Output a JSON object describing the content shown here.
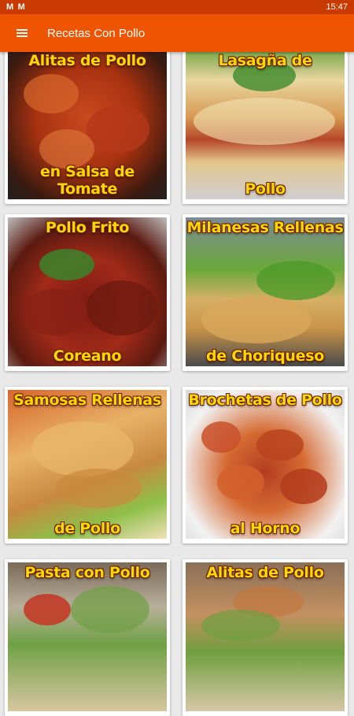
{
  "status_bar": {
    "left_icons": [
      "M",
      "M"
    ],
    "time": "15:47"
  },
  "app_bar": {
    "menu_icon": "hamburger-menu-icon",
    "title": "Recetas Con Pollo"
  },
  "recipes": [
    {
      "top": "Alitas de Pollo",
      "bottom_line1": "en Salsa de",
      "bottom_line2": "Tomate"
    },
    {
      "top": "Lasagña de",
      "bottom_line1": "",
      "bottom_line2": "Pollo"
    },
    {
      "top": "Pollo Frito",
      "bottom_line1": "",
      "bottom_line2": "Coreano"
    },
    {
      "top": "Milanesas Rellenas",
      "bottom_line1": "",
      "bottom_line2": "de Choriqueso"
    },
    {
      "top": "Samosas Rellenas",
      "bottom_line1": "",
      "bottom_line2": "de Pollo"
    },
    {
      "top": "Brochetas de Pollo",
      "bottom_line1": "",
      "bottom_line2": "al Horno"
    },
    {
      "top": "Pasta con Pollo",
      "bottom_line1": "",
      "bottom_line2": ""
    },
    {
      "top": "Alitas de Pollo",
      "bottom_line1": "",
      "bottom_line2": ""
    }
  ],
  "colors": {
    "status_bar": "#c93a00",
    "app_bar": "#ef5400",
    "caption": "#ffd800"
  }
}
